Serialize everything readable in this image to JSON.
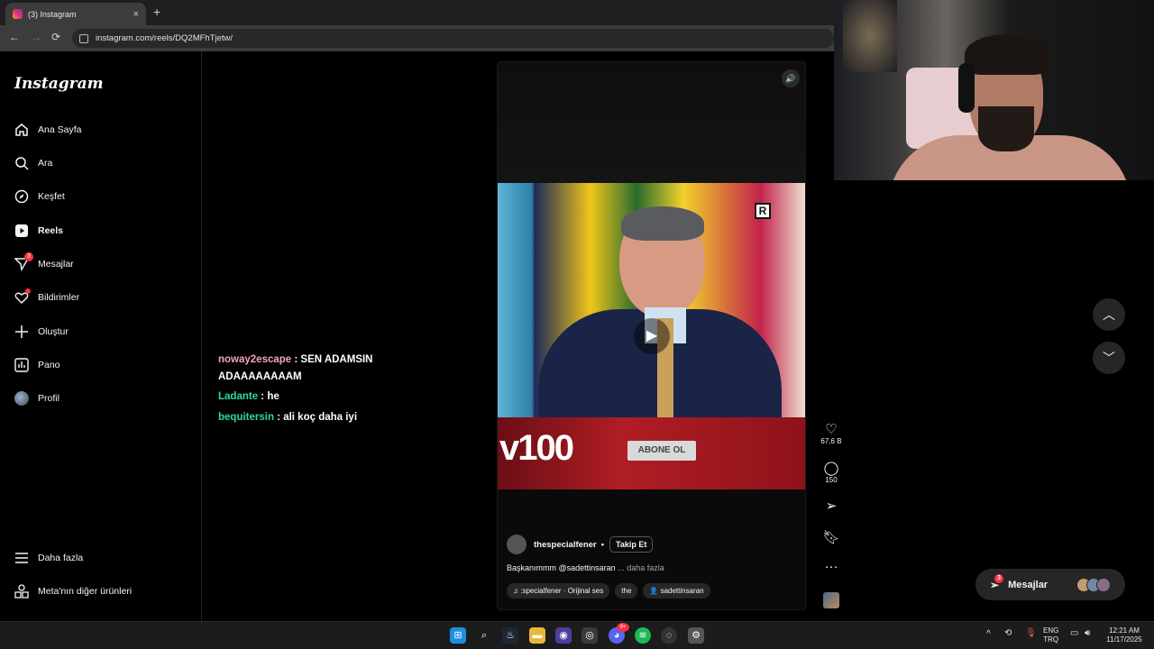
{
  "browser": {
    "tab_title": "(3) Instagram",
    "tab_close": "×",
    "new_tab": "+",
    "url": "instagram.com/reels/DQ2MFhTjetw/",
    "back": "←",
    "forward": "→",
    "reload": "⟳"
  },
  "sidebar": {
    "logo": "Instagram",
    "items": [
      {
        "label": "Ana Sayfa",
        "icon": "home-icon"
      },
      {
        "label": "Ara",
        "icon": "search-icon"
      },
      {
        "label": "Keşfet",
        "icon": "compass-icon"
      },
      {
        "label": "Reels",
        "icon": "reels-icon"
      },
      {
        "label": "Mesajlar",
        "icon": "messenger-icon",
        "badge": "3"
      },
      {
        "label": "Bildirimler",
        "icon": "heart-icon"
      },
      {
        "label": "Oluştur",
        "icon": "plus-icon"
      },
      {
        "label": "Pano",
        "icon": "dashboard-icon"
      },
      {
        "label": "Profil",
        "icon": "avatar"
      }
    ],
    "more": "Daha fazla",
    "meta": "Meta'nın diğer ürünleri"
  },
  "chat": [
    {
      "user": "noway2escape",
      "user_color": "#f6a3c0",
      "message": " : SEN ADAMSIN ADAAAAAAAAM"
    },
    {
      "user": "Ladante",
      "user_color": "#2fd6a8",
      "message": " : he"
    },
    {
      "user": "bequitersin",
      "user_color": "#2fd6a8",
      "message": " : ali koç daha iyi"
    }
  ],
  "reel": {
    "overlay_logo": "R",
    "channel_logo": "v100",
    "subscribe": "ABONE OL",
    "account": "thespecialfener",
    "separator": "•",
    "follow": "Takip Et",
    "caption": "Başkanımmm @sadettinsaran",
    "caption_more": " ... daha fazla",
    "audio": "♫ :specialfener · Orijinal ses",
    "audio_extra": "the",
    "tagged": "sadettinsaran"
  },
  "actions": {
    "likes": "67,6 B",
    "comments": "150"
  },
  "messages_pill": {
    "label": "Mesajlar",
    "badge": "3"
  },
  "taskbar": {
    "lang_top": "ENG",
    "lang_bottom": "TRQ",
    "time": "12:21 AM",
    "date": "11/17/2025",
    "discord_badge": "9+"
  },
  "colors": {
    "badge": "#ff3040",
    "accent_chat": "#2fd6a8"
  }
}
